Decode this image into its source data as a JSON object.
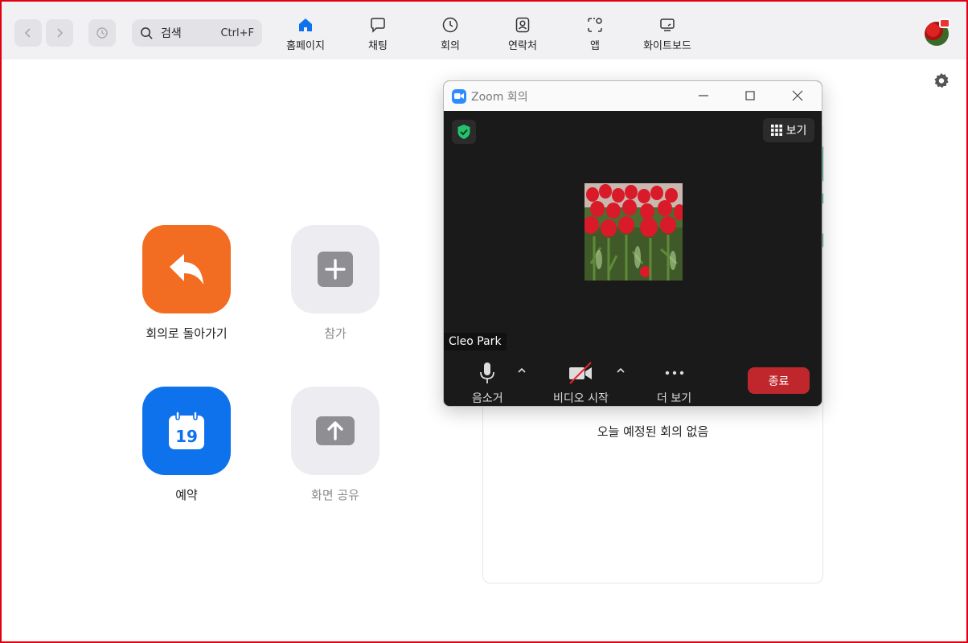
{
  "topbar": {
    "search_label": "검색",
    "search_shortcut": "Ctrl+F",
    "tabs": [
      {
        "label": "홈페이지",
        "icon": "home-icon",
        "active": true
      },
      {
        "label": "채팅",
        "icon": "chat-icon"
      },
      {
        "label": "회의",
        "icon": "clock-icon"
      },
      {
        "label": "연락처",
        "icon": "contacts-icon"
      },
      {
        "label": "앱",
        "icon": "apps-icon"
      },
      {
        "label": "화이트보드",
        "icon": "whiteboard-icon"
      }
    ]
  },
  "home": {
    "actions": [
      {
        "label": "회의로 돌아가기",
        "color": "#f26d21",
        "icon": "return-arrow-icon"
      },
      {
        "label": "참가",
        "color": "#ececf1",
        "icon": "plus-icon"
      },
      {
        "label": "예약",
        "color": "#0e72ed",
        "icon": "calendar-icon",
        "calendar_day": "19"
      },
      {
        "label": "화면 공유",
        "color": "#ececf1",
        "icon": "share-up-arrow-icon"
      }
    ]
  },
  "meetings_panel": {
    "empty_message": "오늘 예정된 회의 없음"
  },
  "meeting_window": {
    "title": "Zoom 회의",
    "view_label": "보기",
    "participant_name": "Cleo Park",
    "controls": {
      "mute_label": "음소거",
      "video_label": "비디오 시작",
      "more_label": "더 보기",
      "end_label": "종료"
    }
  },
  "colors": {
    "accent_blue": "#0e72ed",
    "orange": "#f26d21",
    "end_red": "#c0272d",
    "secure_green": "#23c36b"
  }
}
